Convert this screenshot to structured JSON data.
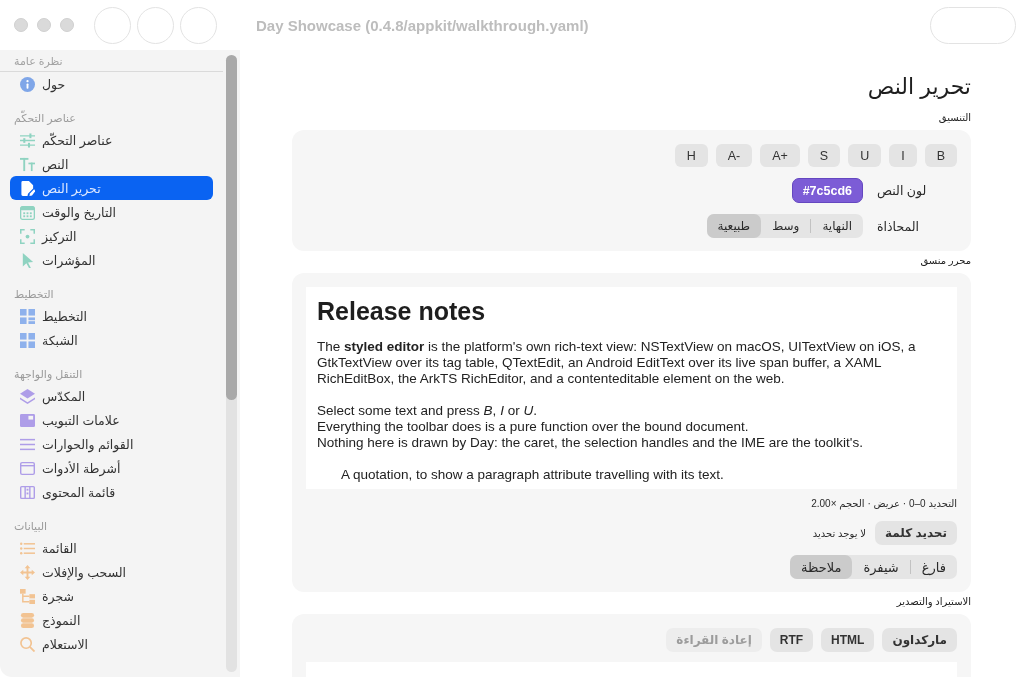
{
  "window": {
    "title": "Day Showcase (0.4.8/appkit/walkthrough.yaml)"
  },
  "sidebar": {
    "sections": [
      {
        "title": "نظرة عامة",
        "color": "#7fa6e8",
        "items": [
          {
            "label": "حول",
            "selected": false
          }
        ]
      },
      {
        "title": "عناصر التحكّم",
        "color": "#8fd3c1",
        "items": [
          {
            "label": "عناصر التحكّم",
            "selected": false
          },
          {
            "label": "النص",
            "selected": false
          },
          {
            "label": "تحرير النص",
            "selected": true
          },
          {
            "label": "التاريخ والوقت",
            "selected": false
          },
          {
            "label": "التركيز",
            "selected": false
          },
          {
            "label": "المؤشرات",
            "selected": false
          }
        ]
      },
      {
        "title": "التخطيط",
        "color": "#8eb1ec",
        "items": [
          {
            "label": "التخطيط",
            "selected": false
          },
          {
            "label": "الشبكة",
            "selected": false
          }
        ]
      },
      {
        "title": "التنقل والواجهة",
        "color": "#ae9de8",
        "items": [
          {
            "label": "المكدّس",
            "selected": false
          },
          {
            "label": "علامات التبويب",
            "selected": false
          },
          {
            "label": "القوائم والحوارات",
            "selected": false
          },
          {
            "label": "أشرطة الأدوات",
            "selected": false
          },
          {
            "label": "قائمة المحتوى",
            "selected": false
          }
        ]
      },
      {
        "title": "البيانات",
        "color": "#f2c392",
        "items": [
          {
            "label": "القائمة",
            "selected": false
          },
          {
            "label": "السحب والإفلات",
            "selected": false
          },
          {
            "label": "شجرة",
            "selected": false
          },
          {
            "label": "النموذج",
            "selected": false
          },
          {
            "label": "الاستعلام",
            "selected": false
          }
        ]
      }
    ]
  },
  "page": {
    "title": "تحرير النص",
    "formatting": {
      "label": "التنسيق",
      "style_buttons": [
        "B",
        "I",
        "U",
        "S",
        "A+",
        "A-",
        "H"
      ],
      "text_color": {
        "label": "لون النص",
        "value": "#7c5cd6",
        "color": "#7c5cd6"
      },
      "alignment": {
        "label": "المحاذاة",
        "options": [
          {
            "label": "النهاية",
            "selected": false
          },
          {
            "label": "وسط",
            "selected": false
          },
          {
            "label": "طبيعية",
            "selected": true
          }
        ]
      }
    },
    "rich_editor": {
      "label": "محرر منسق",
      "blocks": [
        {
          "kind": "heading",
          "text": "Release notes"
        },
        {
          "kind": "paragraph",
          "text": "The **styled editor** is the platform's own rich-text view: NSTextView on macOS, UITextView on iOS, a GtkTextView over its tag table, QTextEdit, an Android EditText over its live span buffer, a XAML RichEditBox, the ArkTS RichEditor, and a contenteditable element on the web."
        },
        {
          "kind": "lines",
          "lines": [
            "Select some text and press *B*, *I* or *U*.",
            "Everything the toolbar does is a pure function over the bound document.",
            "Nothing here is drawn by Day: the caret, the selection handles and the IME are the toolkit's."
          ]
        },
        {
          "kind": "quote",
          "text": "A quotation, to show a paragraph attribute travelling with its text."
        }
      ],
      "status": "التحديد 0–0 · عريض · الحجم ×2.00",
      "select_word_button": "تحديد كلمة",
      "selection_note": "لا يوجد تحديد",
      "block_styles": [
        {
          "label": "فارغ",
          "selected": false
        },
        {
          "label": "شيفرة",
          "selected": false
        },
        {
          "label": "ملاحظة",
          "selected": true
        }
      ]
    },
    "import_export": {
      "label": "الاستيراد والتصدير",
      "buttons": [
        {
          "label": "ماركداون",
          "disabled": false
        },
        {
          "label": "HTML",
          "disabled": false
        },
        {
          "label": "RTF",
          "disabled": false
        },
        {
          "label": "إعادة القراءة",
          "disabled": true
        }
      ]
    }
  }
}
